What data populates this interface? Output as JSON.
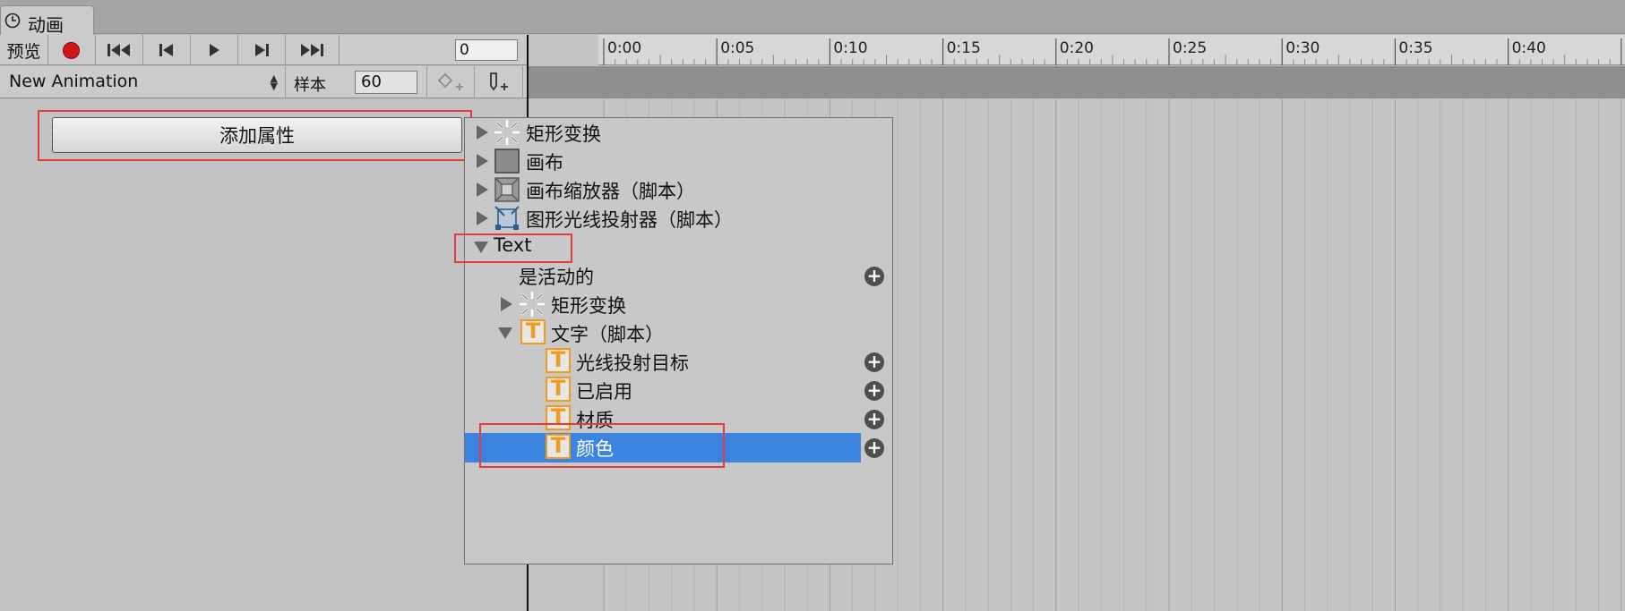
{
  "window": {
    "tab_label": "动画"
  },
  "toolbar": {
    "preview_label": "预览",
    "frame_value": "0",
    "clip_name": "New Animation",
    "sample_label": "样本",
    "sample_value": "60"
  },
  "left_panel": {
    "add_property_label": "添加属性"
  },
  "timeline": {
    "ticks": [
      "0:00",
      "0:05",
      "0:10",
      "0:15",
      "0:20",
      "0:25",
      "0:30",
      "0:35",
      "0:40"
    ]
  },
  "dropdown": {
    "items": [
      {
        "label": "矩形变换",
        "icon": "rect-transform-icon"
      },
      {
        "label": "画布",
        "icon": "canvas-icon"
      },
      {
        "label": "画布缩放器（脚本）",
        "icon": "canvas-scaler-icon"
      },
      {
        "label": "图形光线投射器（脚本）",
        "icon": "graphic-raycaster-icon"
      },
      {
        "label": "Text"
      },
      {
        "label": "是活动的"
      },
      {
        "label": "矩形变换",
        "icon": "rect-transform-icon"
      },
      {
        "label": "文字（脚本）",
        "icon": "text-component-icon"
      },
      {
        "label": "光线投射目标",
        "icon": "text-component-icon"
      },
      {
        "label": "已启用",
        "icon": "text-component-icon"
      },
      {
        "label": "材质",
        "icon": "text-component-icon"
      },
      {
        "label": "颜色",
        "icon": "text-component-icon"
      }
    ]
  },
  "colors": {
    "selection": "#3b85e0",
    "highlight_box": "#e53b3b",
    "record": "#d4141c",
    "text_icon": "#f29a1b"
  }
}
